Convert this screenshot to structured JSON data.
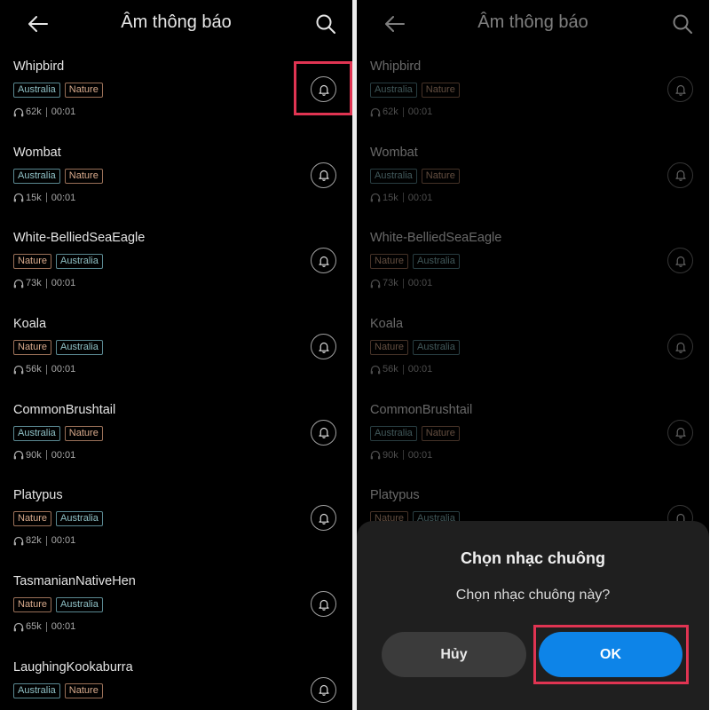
{
  "header": {
    "title": "Âm thông báo"
  },
  "items": [
    {
      "name": "Whipbird",
      "tags": [
        "Australia",
        "Nature"
      ],
      "plays": "62k",
      "duration": "00:01"
    },
    {
      "name": "Wombat",
      "tags": [
        "Australia",
        "Nature"
      ],
      "plays": "15k",
      "duration": "00:01"
    },
    {
      "name": "White-BelliedSeaEagle",
      "tags": [
        "Nature",
        "Australia"
      ],
      "plays": "73k",
      "duration": "00:01"
    },
    {
      "name": "Koala",
      "tags": [
        "Nature",
        "Australia"
      ],
      "plays": "56k",
      "duration": "00:01"
    },
    {
      "name": "CommonBrushtail",
      "tags": [
        "Australia",
        "Nature"
      ],
      "plays": "90k",
      "duration": "00:01"
    },
    {
      "name": "Platypus",
      "tags": [
        "Nature",
        "Australia"
      ],
      "plays": "82k",
      "duration": "00:01"
    },
    {
      "name": "TasmanianNativeHen",
      "tags": [
        "Nature",
        "Australia"
      ],
      "plays": "65k",
      "duration": "00:01"
    },
    {
      "name": "LaughingKookaburra",
      "tags": [
        "Australia",
        "Nature"
      ],
      "plays": "",
      "duration": ""
    }
  ],
  "dialog": {
    "title": "Chọn nhạc chuông",
    "message": "Chọn nhạc chuông này?",
    "cancel_label": "Hủy",
    "ok_label": "OK"
  },
  "colors": {
    "accent": "#0d84e8",
    "highlight": "#e03452",
    "tag_australia": "#8fc1c6",
    "tag_nature": "#d8aa8c"
  }
}
